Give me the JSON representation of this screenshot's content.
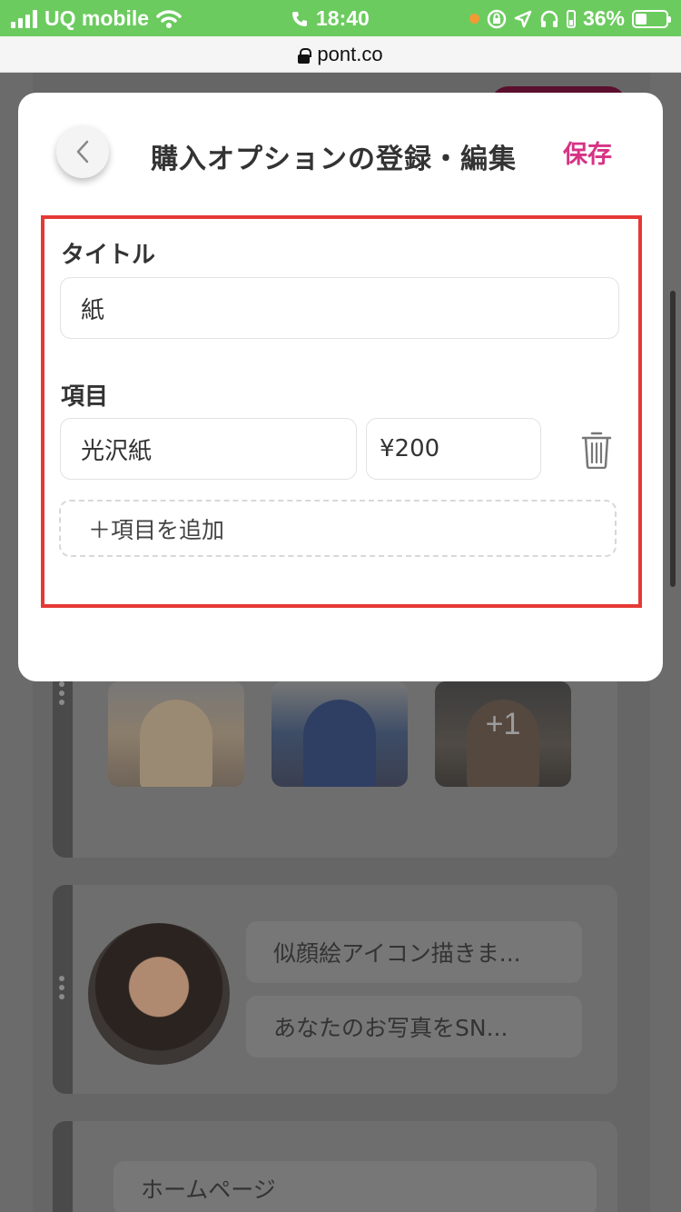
{
  "status_bar": {
    "carrier": "UQ mobile",
    "time": "18:40",
    "battery": "36%"
  },
  "browser": {
    "url": "pont.co"
  },
  "modal": {
    "title": "購入オプションの登録・編集",
    "save_label": "保存",
    "title_label": "タイトル",
    "title_value": "紙",
    "items_label": "項目",
    "items": [
      {
        "name": "光沢紙",
        "price": "¥200"
      }
    ],
    "add_item_label": "＋項目を追加"
  },
  "background": {
    "more_photos": "+1",
    "product_list": [
      "似顔絵アイコン描きま...",
      "あなたのお写真をSN..."
    ],
    "homepage_label": "ホームページ"
  },
  "colors": {
    "status_bar": "#6ccb5f",
    "accent": "#d63384",
    "highlight": "#e53935"
  }
}
